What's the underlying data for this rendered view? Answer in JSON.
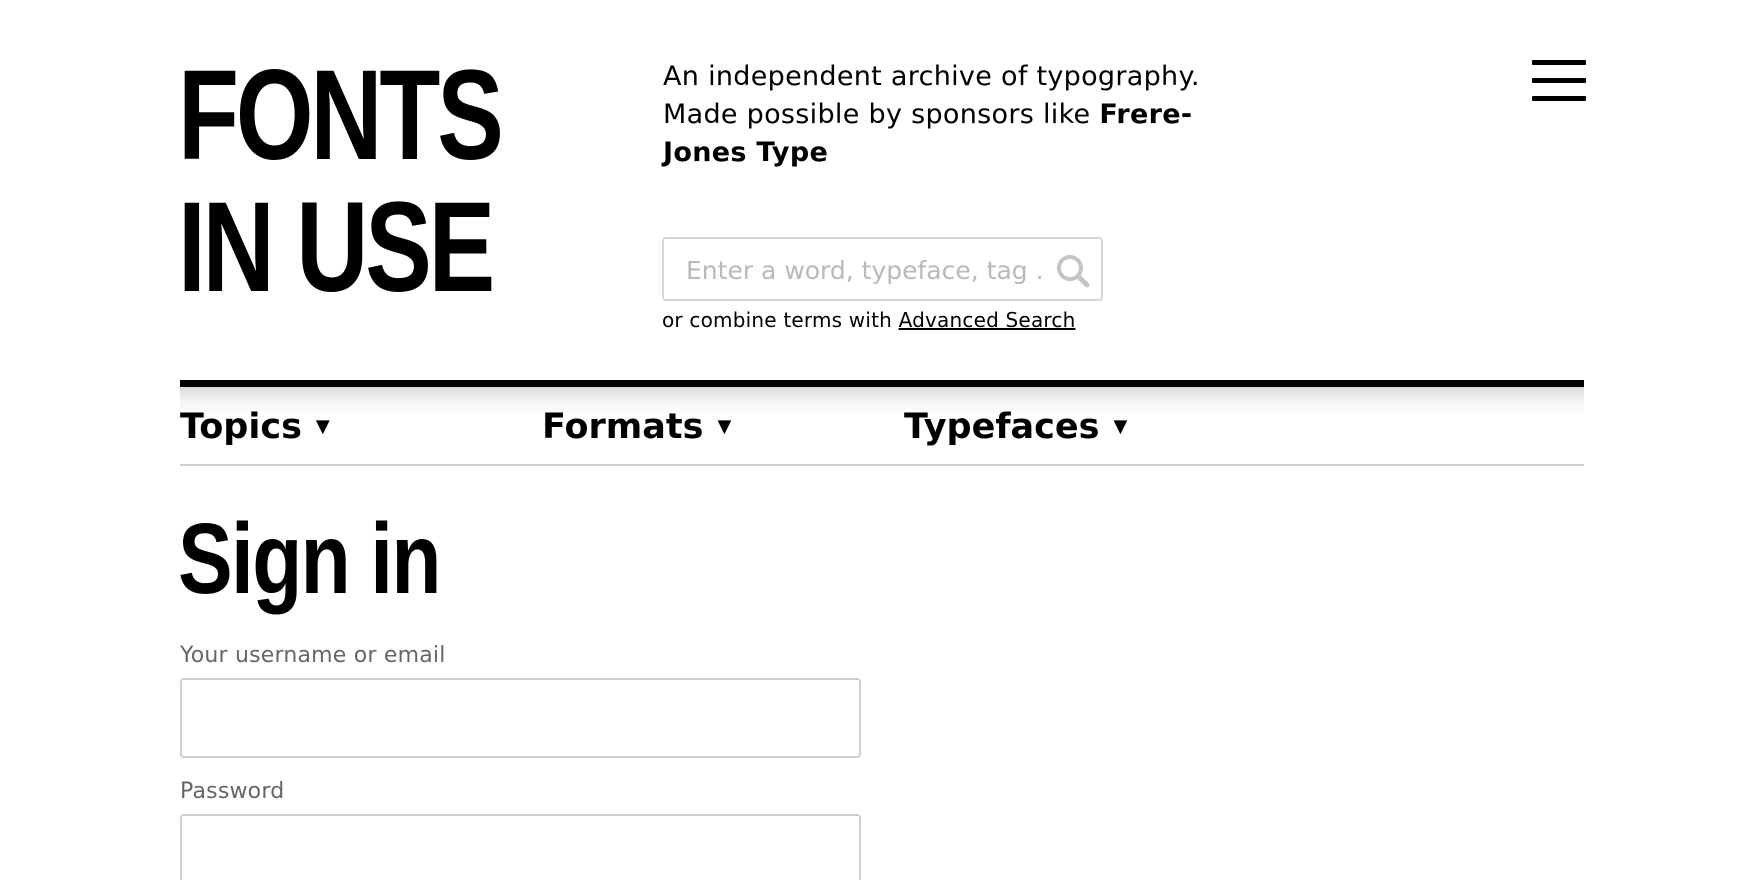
{
  "header": {
    "logo_line1": "FONTS",
    "logo_line2": "IN USE",
    "tagline_line1": "An independent archive of typography.",
    "tagline_prefix": "Made possible by sponsors like ",
    "sponsor_name": "Frere-Jones Type"
  },
  "search": {
    "placeholder": "Enter a word, typeface, tag ...",
    "value": "",
    "hint_prefix": "or combine terms with ",
    "advanced_link": "Advanced Search",
    "icon": "search-icon"
  },
  "menu": {
    "icon": "hamburger-menu-icon"
  },
  "nav": {
    "items": [
      {
        "label": "Topics",
        "caret": "▼"
      },
      {
        "label": "Formats",
        "caret": "▼"
      },
      {
        "label": "Typefaces",
        "caret": "▼"
      }
    ]
  },
  "signin": {
    "title": "Sign in",
    "username_label": "Your username or email",
    "username_value": "",
    "password_label": "Password",
    "password_value": ""
  }
}
